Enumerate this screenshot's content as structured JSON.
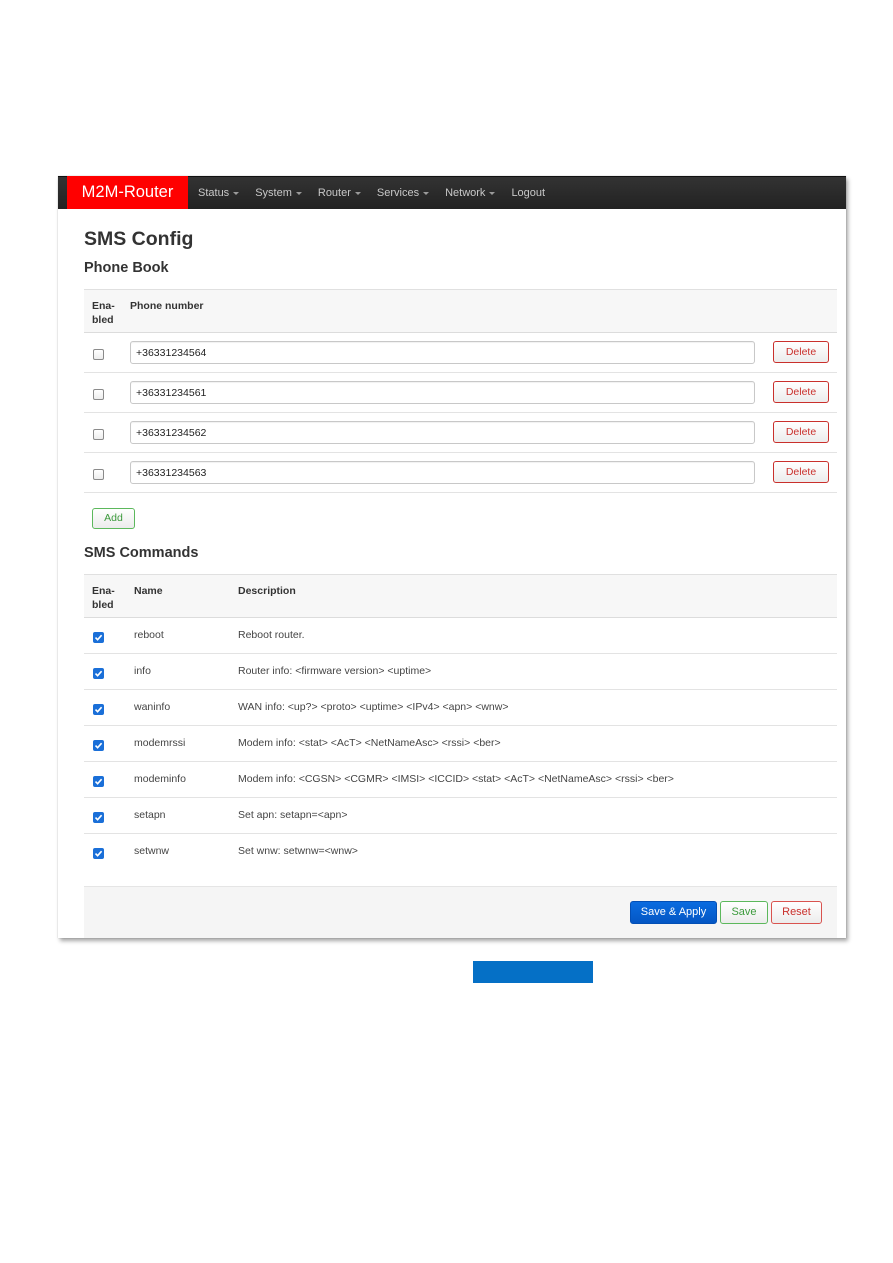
{
  "navbar": {
    "brand": "M2M-Router",
    "brand_color": "#ff0000",
    "items": [
      {
        "label": "Status",
        "dropdown": true
      },
      {
        "label": "System",
        "dropdown": true
      },
      {
        "label": "Router",
        "dropdown": true
      },
      {
        "label": "Services",
        "dropdown": true
      },
      {
        "label": "Network",
        "dropdown": true
      },
      {
        "label": "Logout",
        "dropdown": false
      }
    ]
  },
  "page": {
    "title": "SMS Config"
  },
  "phone_book": {
    "heading": "Phone Book",
    "columns": {
      "enabled": "Ena-\nbled",
      "phone": "Phone number"
    },
    "rows": [
      {
        "enabled": false,
        "phone": "+36331234564",
        "delete_label": "Delete"
      },
      {
        "enabled": false,
        "phone": "+36331234561",
        "delete_label": "Delete"
      },
      {
        "enabled": false,
        "phone": "+36331234562",
        "delete_label": "Delete"
      },
      {
        "enabled": false,
        "phone": "+36331234563",
        "delete_label": "Delete"
      }
    ],
    "add_label": "Add"
  },
  "sms_commands": {
    "heading": "SMS Commands",
    "columns": {
      "enabled": "Ena-\nbled",
      "name": "Name",
      "description": "Description"
    },
    "rows": [
      {
        "enabled": true,
        "name": "reboot",
        "description": "Reboot router."
      },
      {
        "enabled": true,
        "name": "info",
        "description": "Router info: <firmware version> <uptime>"
      },
      {
        "enabled": true,
        "name": "waninfo",
        "description": "WAN info: <up?> <proto> <uptime> <IPv4> <apn> <wnw>"
      },
      {
        "enabled": true,
        "name": "modemrssi",
        "description": "Modem info: <stat> <AcT> <NetNameAsc> <rssi> <ber>"
      },
      {
        "enabled": true,
        "name": "modeminfo",
        "description": "Modem info: <CGSN> <CGMR> <IMSI> <ICCID> <stat> <AcT> <NetNameAsc> <rssi> <ber>"
      },
      {
        "enabled": true,
        "name": "setapn",
        "description": "Set apn: setapn=<apn>"
      },
      {
        "enabled": true,
        "name": "setwnw",
        "description": "Set wnw: setwnw=<wnw>"
      }
    ]
  },
  "footer": {
    "save_apply_label": "Save & Apply",
    "save_label": "Save",
    "reset_label": "Reset"
  },
  "colors": {
    "primary": "#0a6ce0",
    "success": "#5cb85c",
    "danger": "#c9302c"
  }
}
